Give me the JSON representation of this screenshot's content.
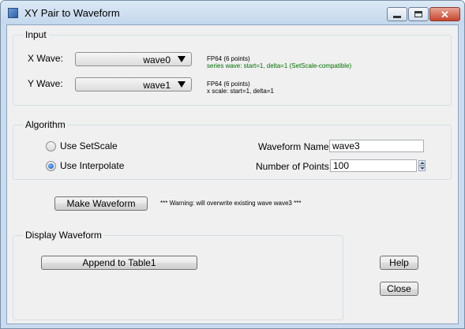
{
  "window": {
    "title": "XY Pair to Waveform"
  },
  "input": {
    "group_label": "Input",
    "x_label": "X Wave:",
    "x_value": "wave0",
    "x_info_1": "FP64 (6 points)",
    "x_info_2": "series wave: start=1, delta=1 (SetScale-compatible)",
    "y_label": "Y Wave:",
    "y_value": "wave1",
    "y_info_1": "FP64 (6 points)",
    "y_info_2": "x scale: start=1, delta=1"
  },
  "algorithm": {
    "group_label": "Algorithm",
    "option_setscale": "Use SetScale",
    "option_interpolate": "Use Interpolate",
    "selected": "Use Interpolate",
    "waveform_name_label": "Waveform Name:",
    "waveform_name_value": "wave3",
    "num_points_label": "Number of Points:",
    "num_points_value": "100"
  },
  "actions": {
    "make_waveform": "Make Waveform",
    "warning": "*** Warning: will overwrite existing wave wave3 ***"
  },
  "display": {
    "group_label": "Display Waveform",
    "append_button": "Append to Table1"
  },
  "buttons": {
    "help": "Help",
    "close": "Close"
  },
  "colors": {
    "info_green": "#007000",
    "titlebar": "#c9dcef",
    "close_button": "#c7452d"
  },
  "icons": [
    "app-icon",
    "minimize-icon",
    "maximize-icon",
    "close-icon",
    "dropdown-arrow-icon",
    "spin-up-icon",
    "spin-down-icon"
  ]
}
